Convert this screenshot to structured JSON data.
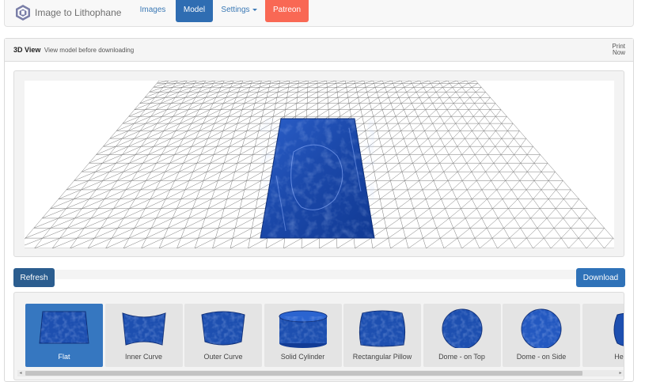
{
  "brand": {
    "name": "Image to Lithophane",
    "icon": "lithophane-logo-icon"
  },
  "nav": {
    "images": "Images",
    "model": "Model",
    "settings": "Settings",
    "patreon": "Patreon"
  },
  "colors": {
    "primary": "#2f6db2",
    "patreon": "#f96854",
    "model_blue": "#1d4fb0"
  },
  "view_panel": {
    "title": "3D View",
    "subtitle": "View model before downloading",
    "print_now_line1": "Print",
    "print_now_line2": "Now"
  },
  "actions": {
    "refresh": "Refresh",
    "download": "Download"
  },
  "shapes": [
    {
      "label": "Flat",
      "selected": true
    },
    {
      "label": "Inner Curve",
      "selected": false
    },
    {
      "label": "Outer Curve",
      "selected": false
    },
    {
      "label": "Solid Cylinder",
      "selected": false
    },
    {
      "label": "Rectangular Pillow",
      "selected": false
    },
    {
      "label": "Dome - on Top",
      "selected": false
    },
    {
      "label": "Dome - on Side",
      "selected": false
    },
    {
      "label": "Hea",
      "selected": false
    }
  ]
}
